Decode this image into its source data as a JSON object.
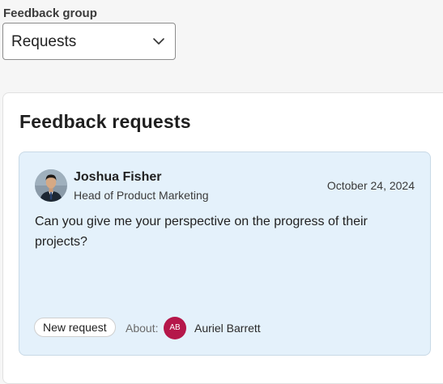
{
  "filter": {
    "label": "Feedback group",
    "selected": "Requests"
  },
  "panel": {
    "title": "Feedback requests"
  },
  "request": {
    "sender_name": "Joshua Fisher",
    "sender_role": "Head of Product Marketing",
    "date": "October 24, 2024",
    "message": "Can you give me your perspective on the progress of their projects?",
    "status_badge": "New request",
    "about_label": "About:",
    "about_initials": "AB",
    "about_name": "Auriel Barrett",
    "about_avatar_color": "#b5174a"
  },
  "icons": {
    "select_chevron": "chevron-down-icon",
    "sender_avatar": "person-photo"
  }
}
